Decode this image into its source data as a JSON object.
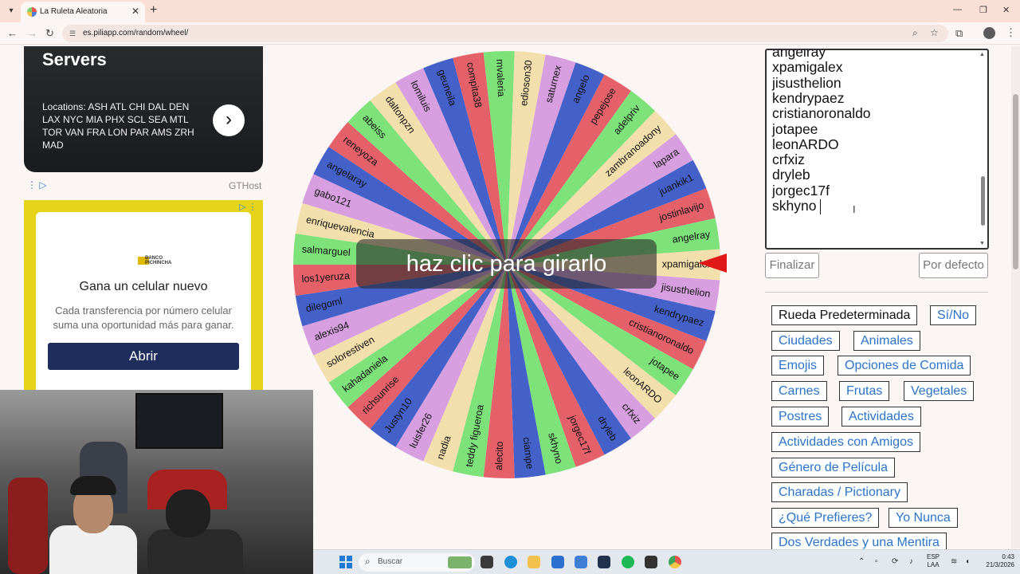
{
  "browser": {
    "tab_title": "La Ruleta Aleatoria",
    "url": "es.piliapp.com/random/wheel/"
  },
  "ads": {
    "servers_title": "Servers",
    "servers_text": "Locations: ASH ATL CHI DAL DEN LAX NYC MIA PHX SCL SEA MTL TOR VAN FRA LON PAR AMS ZRH MAD",
    "advertiser": "GTHost",
    "bank_name": "BANCO PICHINCHA",
    "promo_title": "Gana un celular nuevo",
    "promo_text": "Cada transferencia por número celular suma una oportunidad más para ganar.",
    "promo_button": "Abrir"
  },
  "wheel": {
    "spin_label": "haz clic para girarlo",
    "segments": [
      {
        "label": "xpamigalex",
        "color": "#f2dfac"
      },
      {
        "label": "jisusthelion",
        "color": "#d79ee0"
      },
      {
        "label": "kendrypaez",
        "color": "#4460c9"
      },
      {
        "label": "cristianoronaldo",
        "color": "#e5616a"
      },
      {
        "label": "jotapee",
        "color": "#7ee27a"
      },
      {
        "label": "leonARDO",
        "color": "#f2dfac"
      },
      {
        "label": "crfxiz",
        "color": "#d79ee0"
      },
      {
        "label": "dryleb",
        "color": "#4460c9"
      },
      {
        "label": "jorgec17f",
        "color": "#e5616a"
      },
      {
        "label": "skhyno",
        "color": "#7ee27a"
      },
      {
        "label": "ciampe",
        "color": "#4460c9"
      },
      {
        "label": "alecito",
        "color": "#e5616a"
      },
      {
        "label": "teddy figueroa",
        "color": "#7ee27a"
      },
      {
        "label": "nadia",
        "color": "#f2dfac"
      },
      {
        "label": "luisfer26",
        "color": "#d79ee0"
      },
      {
        "label": "Justyn10",
        "color": "#4460c9"
      },
      {
        "label": "richsunrise",
        "color": "#e5616a"
      },
      {
        "label": "kahadanielа",
        "color": "#7ee27a"
      },
      {
        "label": "solorestiven",
        "color": "#f2dfac"
      },
      {
        "label": "alexis94",
        "color": "#d79ee0"
      },
      {
        "label": "dilegoml",
        "color": "#4460c9"
      },
      {
        "label": "los1yeruza",
        "color": "#e5616a"
      },
      {
        "label": "salmarguel",
        "color": "#7ee27a"
      },
      {
        "label": "enriquevalencia",
        "color": "#f2dfac"
      },
      {
        "label": "gabo121",
        "color": "#d79ee0"
      },
      {
        "label": "angelaray",
        "color": "#4460c9"
      },
      {
        "label": "reneyoza",
        "color": "#e5616a"
      },
      {
        "label": "abeiss",
        "color": "#7ee27a"
      },
      {
        "label": "daltonpzn",
        "color": "#f2dfac"
      },
      {
        "label": "lomiluis",
        "color": "#d79ee0"
      },
      {
        "label": "geuneila",
        "color": "#4460c9"
      },
      {
        "label": "compita38",
        "color": "#e5616a"
      },
      {
        "label": "mvaleria",
        "color": "#7ee27a"
      },
      {
        "label": "edioson30",
        "color": "#f2dfac"
      },
      {
        "label": "saturnex",
        "color": "#d79ee0"
      },
      {
        "label": "angelo",
        "color": "#4460c9"
      },
      {
        "label": "pepejose",
        "color": "#e5616a"
      },
      {
        "label": "adelpriv",
        "color": "#7ee27a"
      },
      {
        "label": "zambranoadony",
        "color": "#f2dfac"
      },
      {
        "label": "lapara",
        "color": "#d79ee0"
      },
      {
        "label": "juankik1",
        "color": "#4460c9"
      },
      {
        "label": "jostinlavijo",
        "color": "#e5616a"
      },
      {
        "label": "angelray",
        "color": "#7ee27a"
      }
    ]
  },
  "names_box": {
    "lines": [
      "angelray",
      "xpamigalex",
      "jisusthelion",
      "kendrypaez",
      "cristianoronaldo",
      "jotapee",
      "leonARDO",
      "crfxiz",
      "dryleb",
      "jorgec17f",
      "skhyno"
    ]
  },
  "buttons": {
    "finalize": "Finalizar",
    "default": "Por defecto"
  },
  "presets": {
    "default_wheel": "Rueda Predeterminada",
    "yes_no": "Sí/No",
    "cities": "Ciudades",
    "animals": "Animales",
    "emojis": "Emojis",
    "food": "Opciones de Comida",
    "meats": "Carnes",
    "fruits": "Frutas",
    "vegetables": "Vegetales",
    "desserts": "Postres",
    "activities": "Actividades",
    "friends": "Actividades con Amigos",
    "genre": "Género de Película",
    "charades": "Charadas / Pictionary",
    "prefer": "¿Qué Prefieres?",
    "never": "Yo Nunca",
    "truths": "Dos Verdades y una Mentira"
  },
  "taskbar": {
    "search_placeholder": "Buscar",
    "lang_top": "ESP",
    "lang_bottom": "LAA",
    "time": "0:43",
    "date": "21/3/2026"
  },
  "colors": {
    "pointer": "#e01818",
    "preset_link": "#2a74c9"
  }
}
